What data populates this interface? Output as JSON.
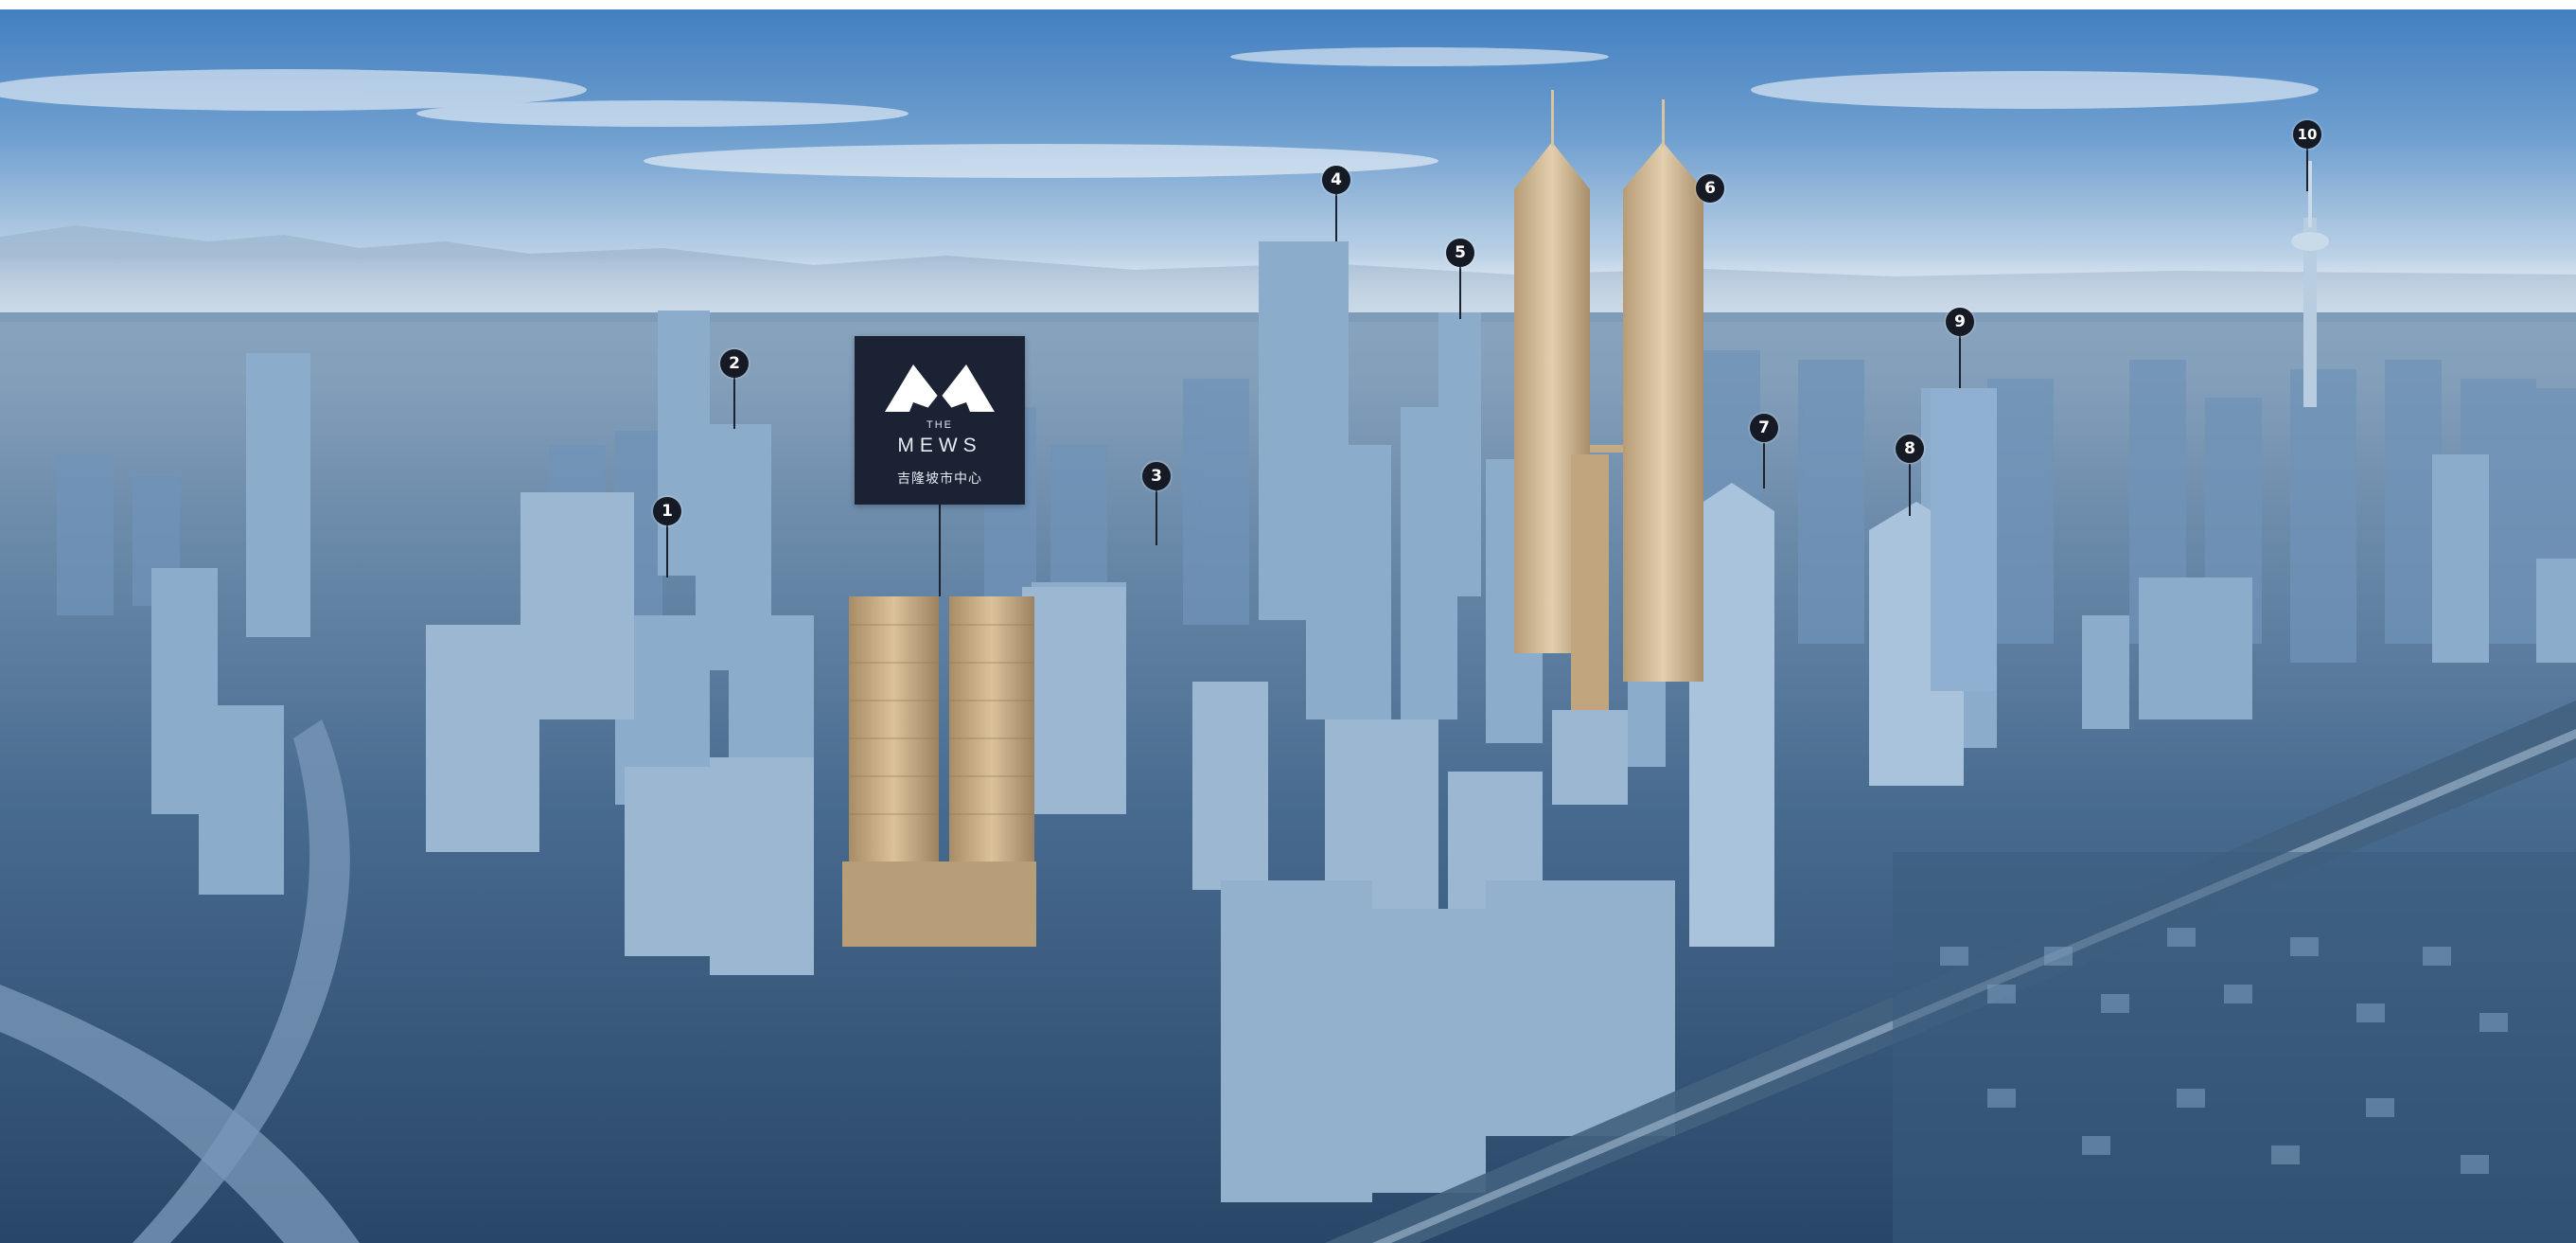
{
  "project": {
    "the": "THE",
    "name": "MEWS",
    "subtitle": "吉隆坡市中心"
  },
  "markers": [
    {
      "label": "1"
    },
    {
      "label": "2"
    },
    {
      "label": "3"
    },
    {
      "label": "4"
    },
    {
      "label": "5"
    },
    {
      "label": "6"
    },
    {
      "label": "7"
    },
    {
      "label": "8"
    },
    {
      "label": "9"
    },
    {
      "label": "10"
    }
  ],
  "colors": {
    "sky_top": "#3f7dbf",
    "haze": "#dbe6ef",
    "city": "#5f86ad",
    "city_dark": "#2c4a6d",
    "tower_gold": "#c9ae86",
    "marker": "#151a24",
    "badge": "#1b2233"
  }
}
